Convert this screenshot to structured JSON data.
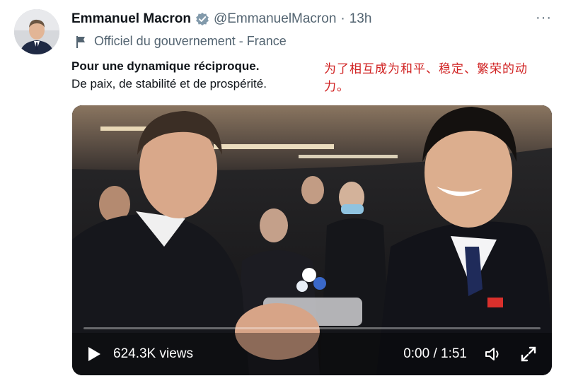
{
  "author": {
    "name": "Emmanuel Macron",
    "handle": "@EmmanuelMacron",
    "separator": "·",
    "time": "13h",
    "verified_icon": "verified-badge-icon",
    "affiliation_icon": "government-flag-icon",
    "affiliation": "Officiel du gouvernement - France"
  },
  "more_icon": "more-options-icon",
  "more_label": "···",
  "tweet": {
    "line1_bold": "Pour une dynamique réciproque.",
    "line2": "De paix, de stabilité et de prospérité.",
    "translation": "为了相互成为和平、稳定、繁荣的动力。"
  },
  "video": {
    "views": "624.3K views",
    "timecode": "0:00 / 1:51",
    "progress": 0,
    "play_icon": "play-icon",
    "volume_icon": "volume-icon",
    "fullscreen_icon": "fullscreen-icon"
  },
  "colors": {
    "verified": "#829aab",
    "translation": "#d02020",
    "muted": "#536471"
  }
}
